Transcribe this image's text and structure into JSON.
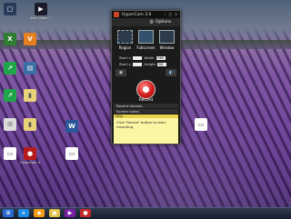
{
  "desktop": {
    "icons": [
      {
        "label": "",
        "glyph": "▢",
        "bg": "#2a3a5a"
      },
      {
        "label": "Miro Video\nConverter",
        "glyph": "▶",
        "bg": "#1b1b2b"
      },
      {
        "label": "",
        "glyph": "X",
        "bg": "#2e7d32"
      },
      {
        "label": "",
        "glyph": "V",
        "bg": "#e67e22"
      },
      {
        "label": "",
        "glyph": "↗",
        "bg": "#1fa64a"
      },
      {
        "label": "",
        "glyph": "▤",
        "bg": "#3a6ea5"
      },
      {
        "label": "",
        "glyph": "↗",
        "bg": "#1fa64a"
      },
      {
        "label": "",
        "glyph": "▮",
        "bg": "#e7d27a"
      },
      {
        "label": "",
        "glyph": "✉",
        "bg": "#dcdcdc"
      },
      {
        "label": "",
        "glyph": "▮",
        "bg": "#e7d27a"
      },
      {
        "label": "",
        "glyph": "▭",
        "bg": "#ffffff"
      },
      {
        "label": "",
        "glyph": "W",
        "bg": "#2b579a"
      },
      {
        "label": "HyperCam 3",
        "glyph": "●",
        "bg": "#b71c1c"
      },
      {
        "label": "",
        "glyph": "▭",
        "bg": "#ffffff"
      },
      {
        "label": "",
        "glyph": "▭",
        "bg": "#ffffff"
      }
    ]
  },
  "window": {
    "title": "HyperCam 3.6",
    "menu_options": "Options",
    "modes": [
      "Region",
      "Fullscreen",
      "Window"
    ],
    "fields": [
      {
        "label": "Start x",
        "value": ""
      },
      {
        "label": "Width",
        "value": "1366"
      },
      {
        "label": "Start y",
        "value": ""
      },
      {
        "label": "Height",
        "value": "768"
      }
    ],
    "record_label": "Record",
    "sections": [
      "Recent records",
      "Screen notes"
    ],
    "help_header": "Help",
    "help_text": "Click 'Record' button to start recording."
  },
  "taskbar": {
    "pinned": [
      {
        "glyph": "⊞",
        "bg": "#2a6bd1"
      },
      {
        "glyph": "e",
        "bg": "#1e88e5"
      },
      {
        "glyph": "◉",
        "bg": "#f39c12"
      },
      {
        "glyph": "▣",
        "bg": "#e0c04a"
      },
      {
        "glyph": "▶",
        "bg": "#7b1fa2"
      },
      {
        "glyph": "●",
        "bg": "#c62828"
      }
    ],
    "clock_time": "",
    "clock_date": ""
  },
  "colors": {
    "accent": "#c62828",
    "help_bg": "#fbf6a4"
  }
}
